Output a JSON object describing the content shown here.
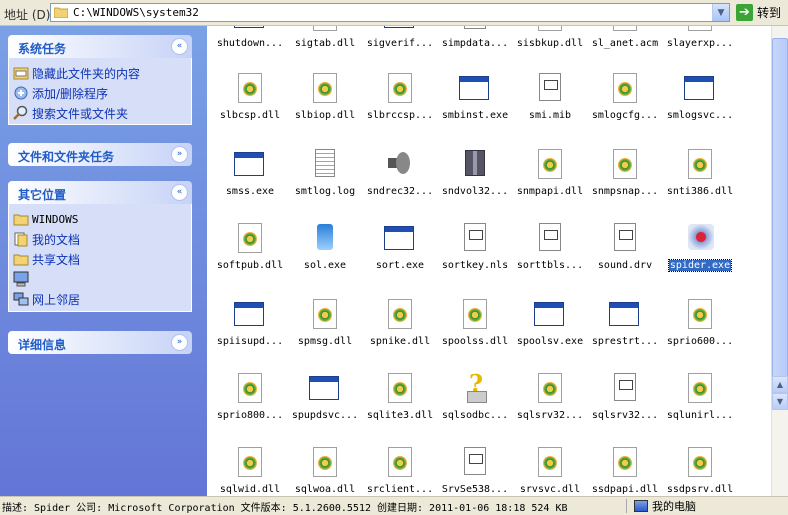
{
  "address_bar": {
    "label": "地址 (D)",
    "path": "C:\\WINDOWS\\system32",
    "go_label": "转到",
    "dropdown_glyph": "▼",
    "go_glyph": "➔"
  },
  "task_pane": {
    "system_tasks": {
      "title": "系统任务",
      "chevron": "«",
      "items": [
        "隐藏此文件夹的内容",
        "添加/删除程序",
        "搜索文件或文件夹"
      ]
    },
    "file_folder_tasks": {
      "title": "文件和文件夹任务",
      "chevron": "»"
    },
    "other_places": {
      "title": "其它位置",
      "chevron": "«",
      "items": [
        "WINDOWS",
        "我的文档",
        "共享文档",
        "",
        "网上邻居"
      ]
    },
    "details": {
      "title": "详细信息",
      "chevron": "»"
    }
  },
  "files": [
    {
      "name": "shutdown...",
      "icon": "exe"
    },
    {
      "name": "sigtab.dll",
      "icon": "dll"
    },
    {
      "name": "sigverif...",
      "icon": "exe"
    },
    {
      "name": "simpdata...",
      "icon": "doc"
    },
    {
      "name": "sisbkup.dll",
      "icon": "dll"
    },
    {
      "name": "sl_anet.acm",
      "icon": "dll"
    },
    {
      "name": "slayerxp...",
      "icon": "dll"
    },
    {
      "name": "slbcsp.dll",
      "icon": "dll"
    },
    {
      "name": "slbiop.dll",
      "icon": "dll"
    },
    {
      "name": "slbrccsp...",
      "icon": "dll"
    },
    {
      "name": "smbinst.exe",
      "icon": "exe"
    },
    {
      "name": "smi.mib",
      "icon": "doc"
    },
    {
      "name": "smlogcfg...",
      "icon": "dll"
    },
    {
      "name": "smlogsvc...",
      "icon": "exe"
    },
    {
      "name": "smss.exe",
      "icon": "exe"
    },
    {
      "name": "smtlog.log",
      "icon": "log"
    },
    {
      "name": "sndrec32...",
      "icon": "sound"
    },
    {
      "name": "sndvol32...",
      "icon": "vol"
    },
    {
      "name": "snmpapi.dll",
      "icon": "dll"
    },
    {
      "name": "snmpsnap...",
      "icon": "dll"
    },
    {
      "name": "snti386.dll",
      "icon": "dll"
    },
    {
      "name": "softpub.dll",
      "icon": "dll"
    },
    {
      "name": "sol.exe",
      "icon": "sol"
    },
    {
      "name": "sort.exe",
      "icon": "exe"
    },
    {
      "name": "sortkey.nls",
      "icon": "doc"
    },
    {
      "name": "sorttbls...",
      "icon": "doc"
    },
    {
      "name": "sound.drv",
      "icon": "doc"
    },
    {
      "name": "spider.exe",
      "icon": "spider",
      "selected": true
    },
    {
      "name": "spiisupd...",
      "icon": "exe"
    },
    {
      "name": "spmsg.dll",
      "icon": "dll"
    },
    {
      "name": "spnike.dll",
      "icon": "dll"
    },
    {
      "name": "spoolss.dll",
      "icon": "dll"
    },
    {
      "name": "spoolsv.exe",
      "icon": "exe"
    },
    {
      "name": "sprestrt...",
      "icon": "exe"
    },
    {
      "name": "sprio600...",
      "icon": "dll"
    },
    {
      "name": "sprio800...",
      "icon": "dll"
    },
    {
      "name": "spupdsvc...",
      "icon": "exe"
    },
    {
      "name": "sqlite3.dll",
      "icon": "dll"
    },
    {
      "name": "sqlsodbc...",
      "icon": "help"
    },
    {
      "name": "sqlsrv32...",
      "icon": "dll"
    },
    {
      "name": "sqlsrv32...",
      "icon": "doc"
    },
    {
      "name": "sqlunirl...",
      "icon": "dll"
    },
    {
      "name": "sqlwid.dll",
      "icon": "dll"
    },
    {
      "name": "sqlwoa.dll",
      "icon": "dll"
    },
    {
      "name": "srclient...",
      "icon": "dll"
    },
    {
      "name": "SrvSe538...",
      "icon": "doc"
    },
    {
      "name": "srvsvc.dll",
      "icon": "dll"
    },
    {
      "name": "ssdpapi.dll",
      "icon": "dll"
    },
    {
      "name": "ssdpsrv.dll",
      "icon": "dll"
    }
  ],
  "status_bar": {
    "text": "描述: Spider 公司: Microsoft Corporation 文件版本: 5.1.2600.5512 创建日期: 2011-01-06 18:18 524 KB",
    "location": "我的电脑"
  },
  "scrollbar": {
    "up_glyph": "▲",
    "down_glyph": "▼"
  }
}
